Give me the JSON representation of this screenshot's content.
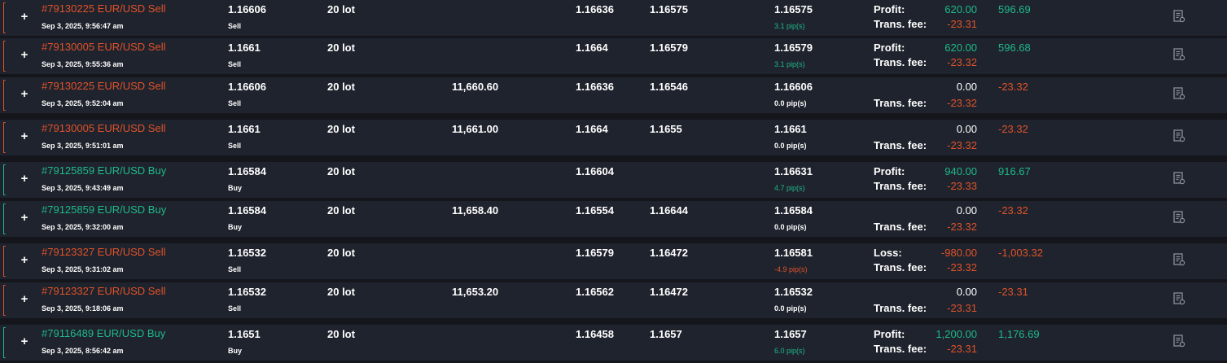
{
  "trades": [
    {
      "side": "sell",
      "title": "#79130225 EUR/USD Sell",
      "date": "Sep 3, 2025, 9:56:47 am",
      "open": "1.16606",
      "type": "Sell",
      "volume": "20 lot",
      "amount": "",
      "sl": "1.16636",
      "tp": "1.16575",
      "close": "1.16575",
      "pips": "3.1 pip(s)",
      "pips_tone": "pos",
      "pnl_label": "Profit:",
      "pnl": "620.00",
      "pnl_tone": "green",
      "fee_label": "Trans. fee:",
      "fee": "-23.31",
      "net": "596.69",
      "net_tone": "green"
    },
    {
      "side": "sell",
      "title": "#79130005 EUR/USD Sell",
      "date": "Sep 3, 2025, 9:55:36 am",
      "open": "1.1661",
      "type": "Sell",
      "volume": "20 lot",
      "amount": "",
      "sl": "1.1664",
      "tp": "1.16579",
      "close": "1.16579",
      "pips": "3.1 pip(s)",
      "pips_tone": "pos",
      "pnl_label": "Profit:",
      "pnl": "620.00",
      "pnl_tone": "green",
      "fee_label": "Trans. fee:",
      "fee": "-23.32",
      "net": "596.68",
      "net_tone": "green"
    },
    {
      "side": "sell",
      "title": "#79130225 EUR/USD Sell",
      "date": "Sep 3, 2025, 9:52:04 am",
      "open": "1.16606",
      "type": "Sell",
      "volume": "20 lot",
      "amount": "11,660.60",
      "sl": "1.16636",
      "tp": "1.16546",
      "close": "1.16606",
      "pips": "0.0 pip(s)",
      "pips_tone": "zero",
      "pnl_label": "",
      "pnl": "0.00",
      "pnl_tone": "white",
      "fee_label": "Trans. fee:",
      "fee": "-23.32",
      "net": "-23.32",
      "net_tone": "red"
    },
    {
      "side": "sell",
      "title": "#79130005 EUR/USD Sell",
      "date": "Sep 3, 2025, 9:51:01 am",
      "open": "1.1661",
      "type": "Sell",
      "volume": "20 lot",
      "amount": "11,661.00",
      "sl": "1.1664",
      "tp": "1.1655",
      "close": "1.1661",
      "pips": "0.0 pip(s)",
      "pips_tone": "zero",
      "pnl_label": "",
      "pnl": "0.00",
      "pnl_tone": "white",
      "fee_label": "Trans. fee:",
      "fee": "-23.32",
      "net": "-23.32",
      "net_tone": "red"
    },
    {
      "side": "buy",
      "title": "#79125859 EUR/USD Buy",
      "date": "Sep 3, 2025, 9:43:49 am",
      "open": "1.16584",
      "type": "Buy",
      "volume": "20 lot",
      "amount": "",
      "sl": "1.16604",
      "tp": "",
      "close": "1.16631",
      "pips": "4.7 pip(s)",
      "pips_tone": "pos",
      "pnl_label": "Profit:",
      "pnl": "940.00",
      "pnl_tone": "green",
      "fee_label": "Trans. fee:",
      "fee": "-23.33",
      "net": "916.67",
      "net_tone": "green"
    },
    {
      "side": "buy",
      "title": "#79125859 EUR/USD Buy",
      "date": "Sep 3, 2025, 9:32:00 am",
      "open": "1.16584",
      "type": "Buy",
      "volume": "20 lot",
      "amount": "11,658.40",
      "sl": "1.16554",
      "tp": "1.16644",
      "close": "1.16584",
      "pips": "0.0 pip(s)",
      "pips_tone": "zero",
      "pnl_label": "",
      "pnl": "0.00",
      "pnl_tone": "white",
      "fee_label": "Trans. fee:",
      "fee": "-23.32",
      "net": "-23.32",
      "net_tone": "red"
    },
    {
      "side": "sell",
      "title": "#79123327 EUR/USD Sell",
      "date": "Sep 3, 2025, 9:31:02 am",
      "open": "1.16532",
      "type": "Sell",
      "volume": "20 lot",
      "amount": "",
      "sl": "1.16579",
      "tp": "1.16472",
      "close": "1.16581",
      "pips": "-4.9 pip(s)",
      "pips_tone": "neg",
      "pnl_label": "Loss:",
      "pnl": "-980.00",
      "pnl_tone": "red",
      "fee_label": "Trans. fee:",
      "fee": "-23.32",
      "net": "-1,003.32",
      "net_tone": "red"
    },
    {
      "side": "sell",
      "title": "#79123327 EUR/USD Sell",
      "date": "Sep 3, 2025, 9:18:06 am",
      "open": "1.16532",
      "type": "Sell",
      "volume": "20 lot",
      "amount": "11,653.20",
      "sl": "1.16562",
      "tp": "1.16472",
      "close": "1.16532",
      "pips": "0.0 pip(s)",
      "pips_tone": "zero",
      "pnl_label": "",
      "pnl": "0.00",
      "pnl_tone": "white",
      "fee_label": "Trans. fee:",
      "fee": "-23.31",
      "net": "-23.31",
      "net_tone": "red"
    },
    {
      "side": "buy",
      "title": "#79116489 EUR/USD Buy",
      "date": "Sep 3, 2025, 8:56:42 am",
      "open": "1.1651",
      "type": "Buy",
      "volume": "20 lot",
      "amount": "",
      "sl": "1.16458",
      "tp": "1.1657",
      "close": "1.1657",
      "pips": "6.0 pip(s)",
      "pips_tone": "pos",
      "pnl_label": "Profit:",
      "pnl": "1,200.00",
      "pnl_tone": "green",
      "fee_label": "Trans. fee:",
      "fee": "-23.31",
      "net": "1,176.69",
      "net_tone": "green"
    }
  ],
  "icons": {
    "expand": "plus-icon",
    "details": "document-icon"
  },
  "colors": {
    "background": "#1f232d",
    "sell": "#e0522a",
    "buy": "#1fb98a",
    "text": "#ffffff"
  }
}
